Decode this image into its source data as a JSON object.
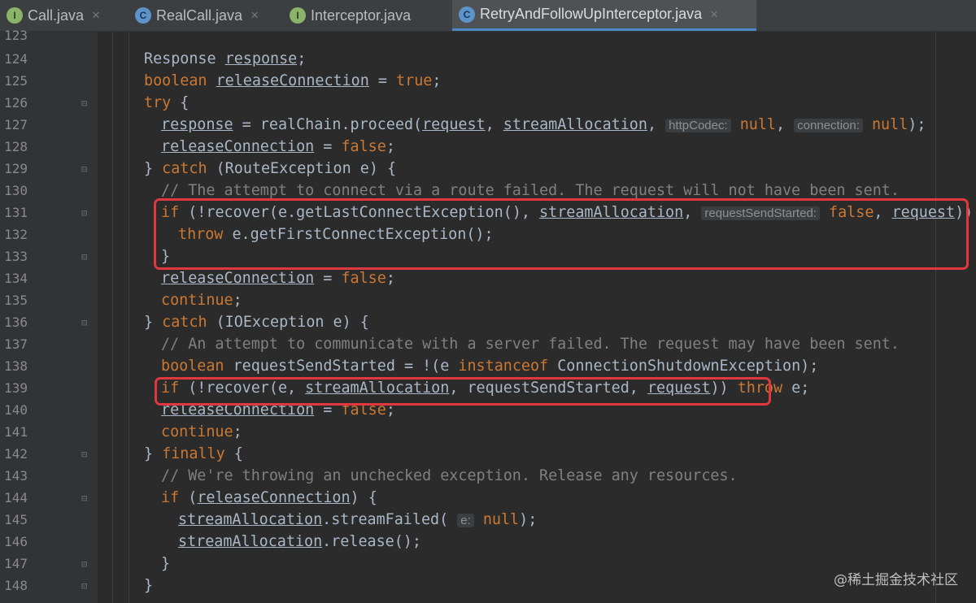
{
  "tabs": [
    {
      "label": "Call.java",
      "icon": "interface-icon",
      "active": false
    },
    {
      "label": "RealCall.java",
      "icon": "class-icon",
      "active": false
    },
    {
      "label": "Interceptor.java",
      "icon": "interface-icon",
      "active": false
    },
    {
      "label": "RetryAndFollowUpInterceptor.java",
      "icon": "class-icon",
      "active": true
    }
  ],
  "tab_close_glyph": "×",
  "line_numbers": [
    "123",
    "124",
    "125",
    "126",
    "127",
    "128",
    "129",
    "130",
    "131",
    "132",
    "133",
    "134",
    "135",
    "136",
    "137",
    "138",
    "139",
    "140",
    "141",
    "142",
    "143",
    "144",
    "145",
    "146",
    "147",
    "148"
  ],
  "code": {
    "resp_type": "Response",
    "var_response": "response",
    "kw_boolean": "boolean",
    "var_releaseConnection": "releaseConnection",
    "kw_true": "true",
    "kw_try": "try",
    "call_proceed": "realChain.proceed(",
    "var_request": "request",
    "var_streamAllocation": "streamAllocation",
    "hint_httpCodec": "httpCodec:",
    "hint_connection": "connection:",
    "kw_null": "null",
    "kw_false": "false",
    "kw_catch": "catch",
    "route_exception": "(RouteException e) {",
    "comment_130": "// The attempt to connect via a route failed. The request will not have been sent.",
    "kw_if": "if",
    "recover_open": "(!recover(e.getLastConnectException(), ",
    "hint_requestSendStarted": "requestSendStarted:",
    "kw_throw": "throw",
    "first_connect": "e.getFirstConnectException();",
    "kw_continue": "continue",
    "io_exception": "(IOException e) {",
    "comment_137": "// An attempt to communicate with a server failed. The request may have been sent.",
    "req_send_started_decl": "requestSendStarted = !(e ",
    "kw_instanceof": "instanceof",
    "conn_shutdown": "ConnectionShutdownException);",
    "recover_139_open": "(!recover(e, ",
    "var_requestSendStarted": "requestSendStarted",
    "throw_e": "e;",
    "kw_finally": "finally",
    "comment_143": "// We're throwing an unchecked exception. Release any resources.",
    "stream_failed": ".streamFailed(",
    "hint_e": "e:",
    "release_call": ".release();"
  },
  "watermark": "@稀土掘金技术社区",
  "colors": {
    "keyword": "#cc7832",
    "text": "#a9b7c6",
    "comment": "#808080",
    "highlight_box": "#e0383e",
    "background": "#2b2b2b"
  }
}
